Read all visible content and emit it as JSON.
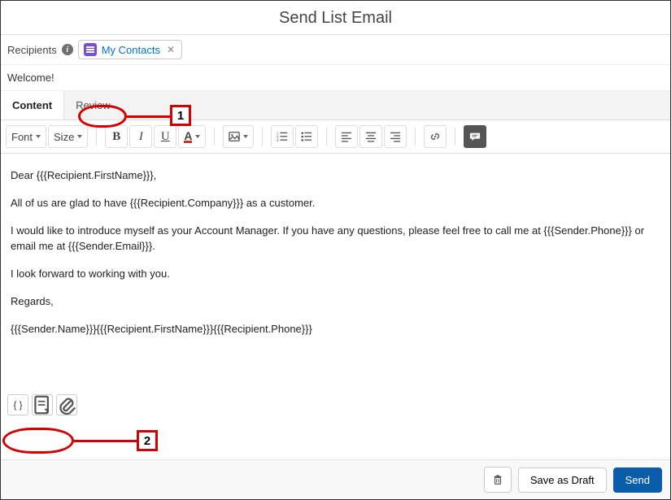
{
  "header": {
    "title": "Send List Email"
  },
  "recipients": {
    "label": "Recipients",
    "chip": {
      "text": "My Contacts"
    }
  },
  "subject": {
    "text": "Welcome!"
  },
  "tabs": {
    "content": "Content",
    "review": "Review"
  },
  "toolbar": {
    "font": "Font",
    "size": "Size"
  },
  "body": {
    "p1": "Dear {{{Recipient.FirstName}}},",
    "p2": "All of us are glad to have {{{Recipient.Company}}} as a customer.",
    "p3": "I would like to introduce myself as your Account Manager.  If you have any questions, please feel free to call me at {{{Sender.Phone}}} or email me at {{{Sender.Email}}}.",
    "p4": "I look forward to working with you.",
    "p5": "Regards,",
    "p6": "{{{Sender.Name}}}{{{Recipient.FirstName}}}{{{Recipient.Phone}}}"
  },
  "bottomToolbar": {
    "merge": "{ }"
  },
  "footer": {
    "saveDraft": "Save as Draft",
    "send": "Send"
  },
  "callouts": {
    "one": "1",
    "two": "2"
  }
}
